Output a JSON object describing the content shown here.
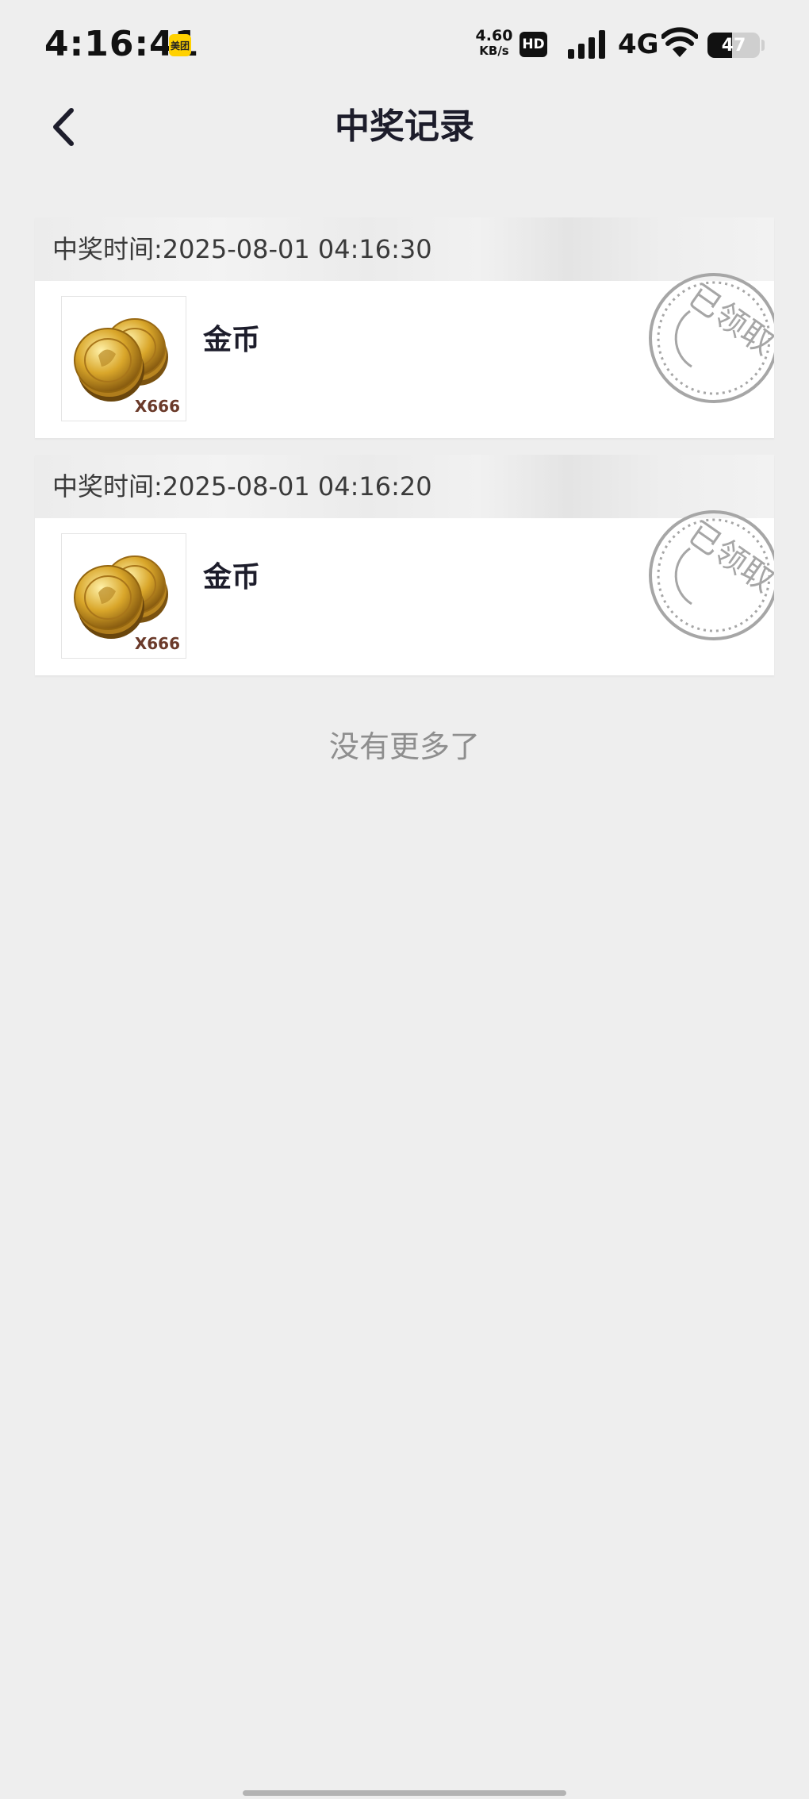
{
  "status_bar": {
    "time": "4:16:41",
    "app_badge": "美团",
    "net_speed_value": "4.60",
    "net_speed_unit": "KB/s",
    "hd_label": "HD",
    "network_type": "4G",
    "battery_level": "47",
    "battery_fraction": 0.47
  },
  "header": {
    "title": "中奖记录"
  },
  "records": [
    {
      "time_text": "中奖时间:2025-08-01 04:16:30",
      "prize_name": "金币",
      "quantity": "X666",
      "stamp": "已领取"
    },
    {
      "time_text": "中奖时间:2025-08-01 04:16:20",
      "prize_name": "金币",
      "quantity": "X666",
      "stamp": "已领取"
    }
  ],
  "footer": {
    "no_more_text": "没有更多了"
  },
  "colors": {
    "background": "#eeeeee",
    "card": "#ffffff",
    "title_text": "#1d1d2b",
    "stamp_gray": "#a6a6a6",
    "coin_gold": "#d9a62a"
  }
}
